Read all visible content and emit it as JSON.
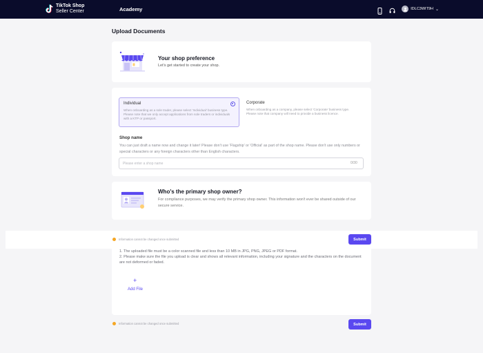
{
  "header": {
    "brand_line1": "TikTok Shop",
    "brand_line2": "Seller Center",
    "nav_academy": "Academy",
    "username": "IDLC3WIT9H"
  },
  "page": {
    "title": "Upload Documents"
  },
  "preference": {
    "title": "Your shop preference",
    "subtitle": "Let's get started to create your shop."
  },
  "shop_type": {
    "individual": {
      "title": "Individual",
      "description": "When onboarding as a sole trader, please select 'Individual' business type. Please note that we only accept applications from sole traders or individuals with a KTP or passport.",
      "selected": true
    },
    "corporate": {
      "title": "Corporate",
      "description": "When onboarding as a company, please select 'Corporate' business type. Please note that company will need to provide a business licence.",
      "selected": false
    }
  },
  "shop_name": {
    "label": "Shop name",
    "help": "You can just draft a name now and change it later! Please don't use 'Flagship' or 'Official' as part of the shop name. Please don't use only numbers or special characters or any foreign characters other than English characters.",
    "placeholder": "Please enter a shop name",
    "counter": "0/30"
  },
  "owner": {
    "title": "Who's the primary shop owner?",
    "subtitle": "For compliance purposes, we may verify the primary shop owner. This information won't ever be shared outside of our secure service."
  },
  "notice": {
    "text1": "Information cannot be changed once submitted",
    "text2": "Information cannot be changed once submitted",
    "submit_label": "Submit"
  },
  "upload": {
    "req1": "1. The uploaded file must be a color scanned file and less than 10 MB in JPG, PNG, JPEG or PDF format.",
    "req2": "2. Please make sure the file you upload is clear and shows all relevant information, including your signature and the characters on the document are not deformed or faded.",
    "plus": "+",
    "add_file": "Add File"
  },
  "colors": {
    "topbar": "#0a0c2b",
    "accent": "#5a48f0",
    "warning": "#f5a623",
    "selected_bg": "#f4f2fe"
  }
}
